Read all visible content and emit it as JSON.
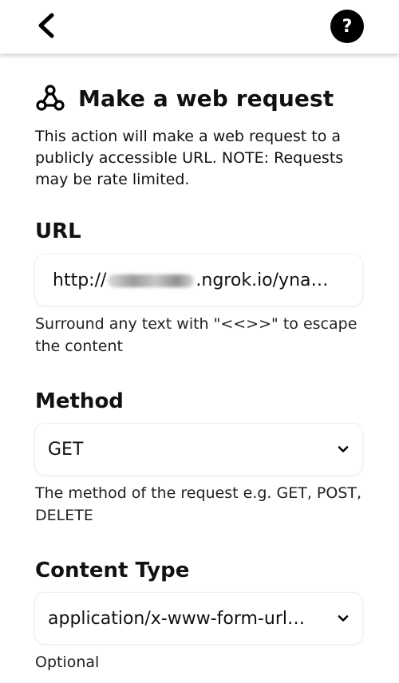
{
  "nav": {
    "back_icon": "chevron-left-icon",
    "help_label": "?"
  },
  "action": {
    "icon": "webhook-icon",
    "title": "Make a web request",
    "description": "This action will make a web request to a publicly accessible URL. NOTE: Requests may be rate limited."
  },
  "url": {
    "label": "URL",
    "value_prefix": "http://",
    "value_suffix": ".ngrok.io/yna…",
    "help": "Surround any text with \"<<>>\" to escape the content"
  },
  "method": {
    "label": "Method",
    "value": "GET",
    "help": "The method of the request e.g. GET, POST, DELETE"
  },
  "content_type": {
    "label": "Content Type",
    "value": "application/x-www-form-url…",
    "help": "Optional"
  }
}
